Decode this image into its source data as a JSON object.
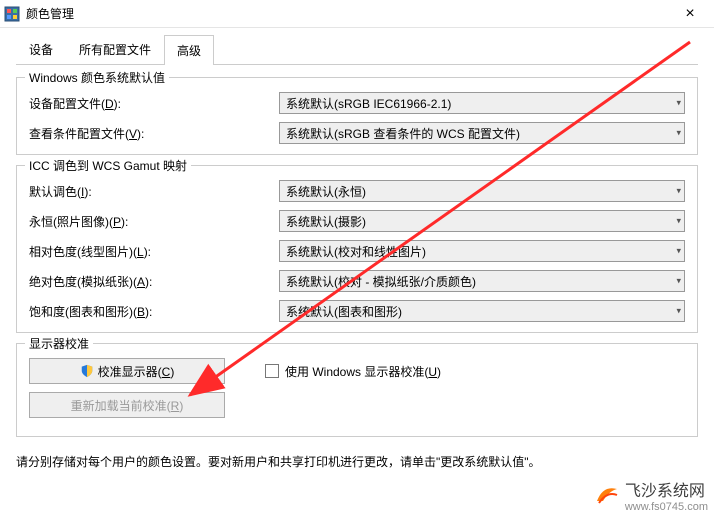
{
  "window": {
    "title": "颜色管理",
    "close_glyph": "×"
  },
  "tabs": {
    "devices": "设备",
    "all_profiles": "所有配置文件",
    "advanced": "高级"
  },
  "group1": {
    "title": "Windows 颜色系统默认值",
    "device_profile_label": "设备配置文件(D):",
    "device_profile_value": "系统默认(sRGB IEC61966-2.1)",
    "viewing_cond_label": "查看条件配置文件(V):",
    "viewing_cond_value": "系统默认(sRGB 查看条件的 WCS 配置文件)"
  },
  "group2": {
    "title": "ICC 调色到 WCS Gamut 映射",
    "default_intent_label": "默认调色(I):",
    "default_intent_value": "系统默认(永恒)",
    "perceptual_label": "永恒(照片图像)(P):",
    "perceptual_value": "系统默认(摄影)",
    "rel_col_label": "相对色度(线型图片)(L):",
    "rel_col_value": "系统默认(校对和线性图片)",
    "abs_col_label": "绝对色度(模拟纸张)(A):",
    "abs_col_value": "系统默认(校对 - 模拟纸张/介质颜色)",
    "saturation_label": "饱和度(图表和图形)(B):",
    "saturation_value": "系统默认(图表和图形)"
  },
  "group3": {
    "title": "显示器校准",
    "calibrate_btn": "校准显示器(C)",
    "use_windows_calib": "使用 Windows 显示器校准(U)",
    "reload_btn": "重新加载当前校准(R)"
  },
  "footer": "请分别存储对每个用户的颜色设置。要对新用户和共享打印机进行更改，请单击\"更改系统默认值\"。",
  "watermark": {
    "name": "飞沙系统网",
    "url": "www.fs0745.com"
  }
}
